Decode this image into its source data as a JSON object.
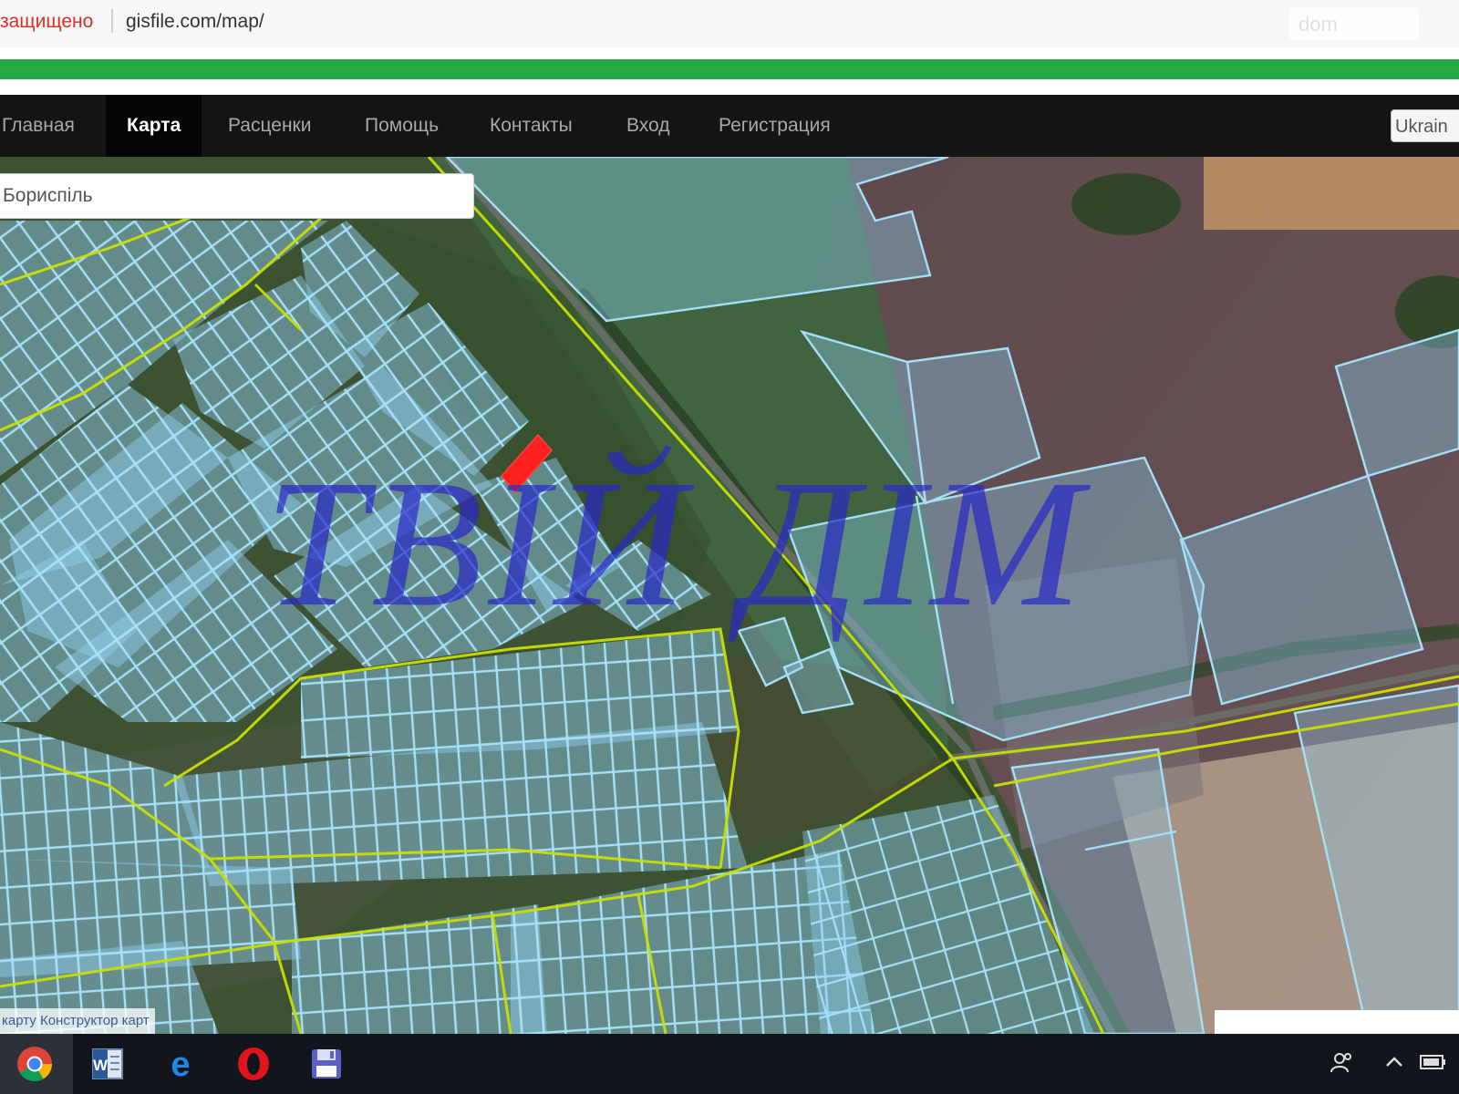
{
  "browser": {
    "security_label": "защищено",
    "url": "gisfile.com/map/",
    "watermark_text": "dom"
  },
  "nav": {
    "items": [
      {
        "label": "Главная",
        "active": false
      },
      {
        "label": "Карта",
        "active": true
      },
      {
        "label": "Расценки",
        "active": false
      },
      {
        "label": "Помощь",
        "active": false
      },
      {
        "label": "Контакты",
        "active": false
      },
      {
        "label": "Вход",
        "active": false
      },
      {
        "label": "Регистрация",
        "active": false
      }
    ],
    "language": "Ukrain"
  },
  "map": {
    "search_value": "Бориспіль",
    "watermark": "ТВІЙ ДІМ",
    "links": [
      "карту",
      "Конструктор карт"
    ]
  },
  "taskbar": {
    "apps": [
      "chrome-icon",
      "word-icon",
      "edge-icon",
      "opera-icon",
      "floppy-icon"
    ],
    "tray": [
      "people-icon",
      "chevron-up-icon",
      "battery-icon"
    ]
  },
  "colors": {
    "progress": "#28a745",
    "nav_bg": "#141414",
    "parcel": "#8fd0f0",
    "boundary": "#c8e000",
    "highlight_parcel": "#ff2020",
    "watermark": "#2828c8"
  }
}
